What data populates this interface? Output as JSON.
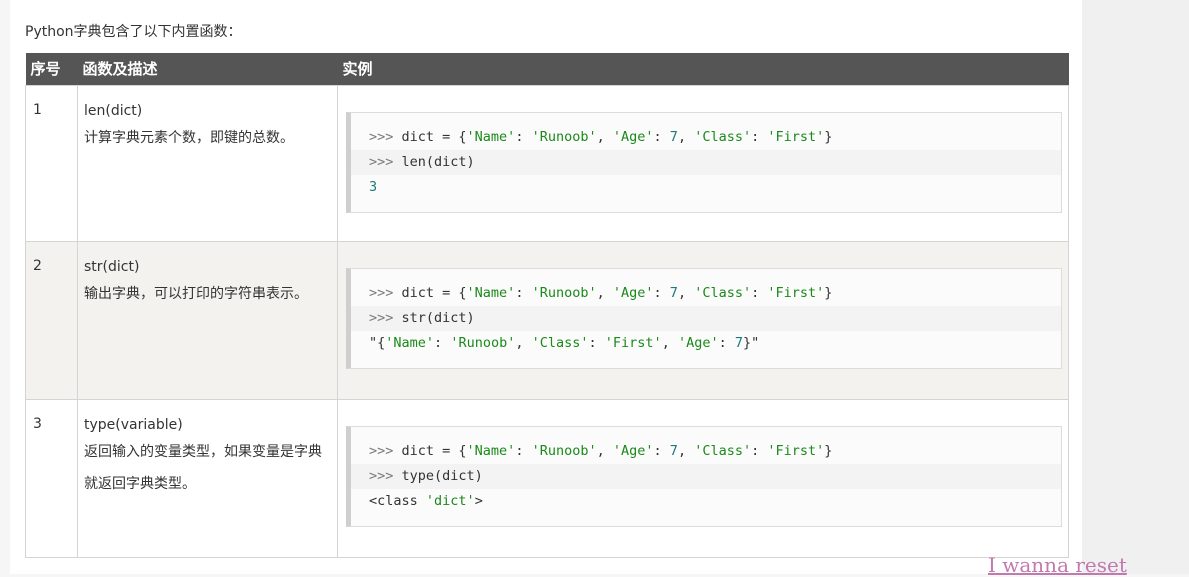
{
  "intro": "Python字典包含了以下内置函数：",
  "table": {
    "headers": [
      "序号",
      "函数及描述",
      "实例"
    ],
    "rows": [
      {
        "num": "1",
        "func": "len(dict)",
        "desc": "计算字典元素个数，即键的总数。",
        "code": [
          ">>> dict = {'Name': 'Runoob', 'Age': 7, 'Class': 'First'}",
          ">>> len(dict)",
          "3"
        ]
      },
      {
        "num": "2",
        "func": "str(dict)",
        "desc": "输出字典，可以打印的字符串表示。",
        "code": [
          ">>> dict = {'Name': 'Runoob', 'Age': 7, 'Class': 'First'}",
          ">>> str(dict)",
          "\"{'Name': 'Runoob', 'Class': 'First', 'Age': 7}\""
        ]
      },
      {
        "num": "3",
        "func": "type(variable)",
        "desc": "返回输入的变量类型，如果变量是字典就返回字典类型。",
        "code": [
          ">>> dict = {'Name': 'Runoob', 'Age': 7, 'Class': 'First'}",
          ">>> type(dict)",
          "<class 'dict'>"
        ]
      }
    ]
  },
  "watermark": "I wanna reset"
}
